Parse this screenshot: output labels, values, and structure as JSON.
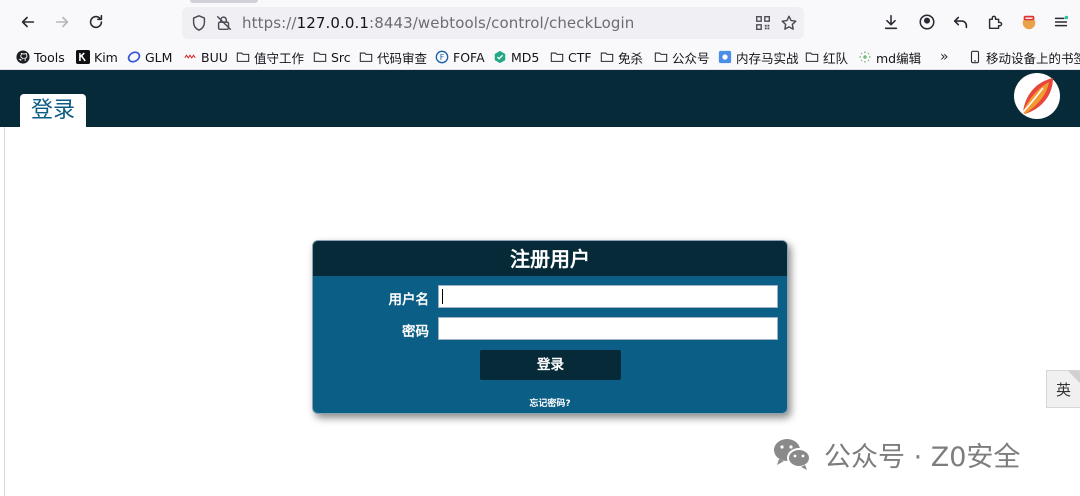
{
  "browser": {
    "url_scheme": "https://",
    "url_host": "127.0.0.1",
    "url_rest": ":8443/webtools/control/checkLogin"
  },
  "bookmarks": [
    {
      "label": "Tools",
      "icon": "github-icon"
    },
    {
      "label": "Kim",
      "icon": "kimi-icon"
    },
    {
      "label": "GLM",
      "icon": "glm-icon"
    },
    {
      "label": "BUU",
      "icon": "buu-icon"
    },
    {
      "label": "值守工作",
      "icon": "folder-icon"
    },
    {
      "label": "Src",
      "icon": "folder-icon"
    },
    {
      "label": "代码审查",
      "icon": "folder-icon"
    },
    {
      "label": "FOFA",
      "icon": "fofa-icon"
    },
    {
      "label": "MD5",
      "icon": "md5-icon"
    },
    {
      "label": "CTF",
      "icon": "folder-icon"
    },
    {
      "label": "免杀",
      "icon": "folder-icon"
    },
    {
      "label": "公众号",
      "icon": "folder-icon"
    },
    {
      "label": "内存马实战",
      "icon": "page-icon"
    },
    {
      "label": "红队",
      "icon": "folder-icon"
    },
    {
      "label": "md编辑",
      "icon": "sparkle-icon"
    }
  ],
  "mobile_bookmarks": "移动设备上的书签",
  "app": {
    "tab_label": "登录",
    "form_title": "注册用户",
    "username_label": "用户名",
    "username_value": "",
    "password_label": "密码",
    "password_value": "",
    "login_button": "登录",
    "forgot_link": "忘记密码?"
  },
  "lang_toggle": "英",
  "watermark": "公众号 · Z0安全",
  "colors": {
    "header_bg": "#072a39",
    "form_bg": "#0b5e86",
    "tab_text": "#0c5b84"
  }
}
